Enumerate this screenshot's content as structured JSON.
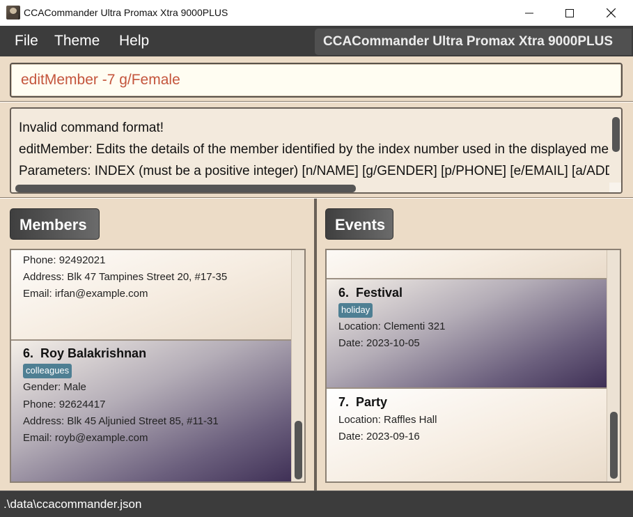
{
  "window": {
    "title": "CCACommander Ultra Promax Xtra 9000PLUS",
    "icon": "app-portrait-icon"
  },
  "menu": {
    "items": [
      "File",
      "Theme",
      "Help"
    ],
    "app_name": "CCACommander Ultra Promax Xtra 9000PLUS"
  },
  "command_box": {
    "value": "editMember -7 g/Female",
    "text_color": "#c4553c"
  },
  "result_display": {
    "lines": [
      "Invalid command format!",
      "editMember: Edits the details of the member identified by the index number used in the displayed member list.",
      "Parameters: INDEX (must be a positive integer) [n/NAME] [g/GENDER] [p/PHONE] [e/EMAIL] [a/ADDRESS] [t/TAG]..."
    ]
  },
  "members_panel": {
    "header": "Members",
    "cards": [
      {
        "phone": "Phone: 92492021",
        "address": "Address: Blk 47 Tampines Street 20, #17-35",
        "email": "Email: irfan@example.com"
      },
      {
        "index": "6.",
        "name": "Roy Balakrishnan",
        "tag": "colleagues",
        "gender": "Gender: Male",
        "phone": "Phone: 92624417",
        "address": "Address: Blk 45 Aljunied Street 85, #11-31",
        "email": "Email: royb@example.com"
      }
    ]
  },
  "events_panel": {
    "header": "Events",
    "cards": [
      {
        "index": "6.",
        "name": "Festival",
        "tag": "holiday",
        "location": "Location: Clementi 321",
        "date": "Date: 2023-10-05"
      },
      {
        "index": "7.",
        "name": "Party",
        "location": "Location: Raffles Hall",
        "date": "Date: 2023-09-16"
      }
    ]
  },
  "status_bar": {
    "path": ".\\data\\ccacommander.json"
  },
  "colors": {
    "menu_bg": "#3c3c3c",
    "panel_bg": "#ecdcc7",
    "tag_bg": "#4e7f93"
  }
}
